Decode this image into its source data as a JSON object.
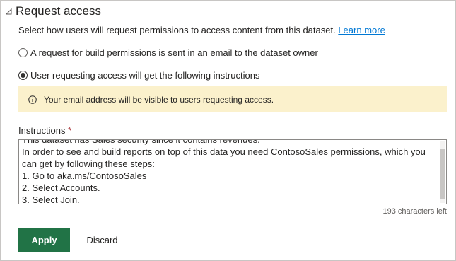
{
  "section": {
    "title": "Request access",
    "description": "Select how users will request permissions to access content from this dataset.",
    "learn_more": "Learn more"
  },
  "options": {
    "email_owner": "A request for build permissions is sent in an email to the dataset owner",
    "instructions": "User requesting access will get the following instructions",
    "selected": "instructions"
  },
  "info_message": "Your email address will be visible to users requesting access.",
  "instructions_field": {
    "label": "Instructions",
    "required_marker": "*",
    "value": "This dataset has Sales security since it contains revenues.\nIn order to see and build reports on top of this data you need ContosoSales permissions, which you can get by following these steps:\n1. Go to aka.ms/ContosoSales\n2. Select Accounts.\n3. Select Join.",
    "counter": "193 characters left"
  },
  "buttons": {
    "apply": "Apply",
    "discard": "Discard"
  },
  "colors": {
    "primary": "#217346",
    "info_background": "#fbf1cc",
    "link": "#0078d4"
  }
}
